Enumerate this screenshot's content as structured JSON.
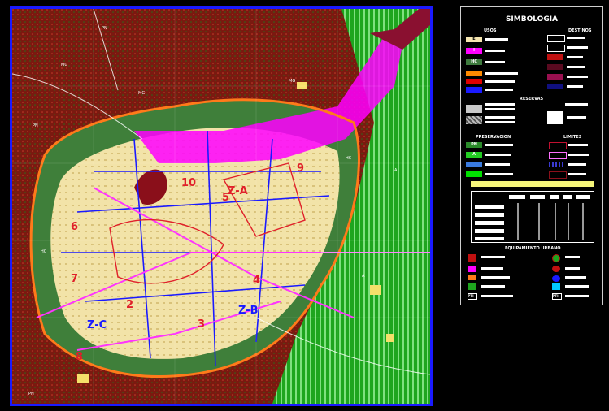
{
  "legend": {
    "title": "SIMBOLOGIA",
    "sections": {
      "usos": "USOS",
      "destinos": "DESTINOS",
      "reservas": "RESERVAS",
      "preservacion": "PRESERVACION",
      "limites": "LIMITES",
      "equipamiento": "EQUIPAMIENTO URBANO"
    },
    "usos_items": [
      {
        "code": "E",
        "color": "#f5e6b0"
      },
      {
        "code": "I",
        "color": "#ff00ff"
      },
      {
        "code": "HC",
        "color": "#3d7a3d"
      },
      {
        "code": "",
        "color": "#ff8a00"
      },
      {
        "code": "",
        "color": "#e00000"
      },
      {
        "code": "",
        "color": "#1a1aff"
      }
    ],
    "preservacion_items": [
      {
        "code": "PN",
        "color": "#2a8a2a"
      },
      {
        "code": "A",
        "color": "#22cc22"
      },
      {
        "code": "",
        "color": "#3a7adf"
      },
      {
        "code": "",
        "color": "#00e000"
      }
    ],
    "equip_codes": [
      "PTI",
      "PTI"
    ]
  },
  "map": {
    "zone_labels": [
      "Z-A",
      "Z-B",
      "Z-C",
      "9",
      "10",
      "5",
      "7",
      "2",
      "3",
      "4",
      "6",
      "8"
    ],
    "area_labels": {
      "forest": "PN",
      "mountain": "MG",
      "agri": "A",
      "habit": "HC"
    },
    "colors": {
      "forest": "#7a1a10",
      "agri_green": "#1ea51e",
      "agri_stripe": "#5dd95d",
      "urban_cream": "#f2e3a8",
      "industrial": "#ff00ff",
      "boundary_blue": "#1a1aff",
      "roads_orange": "#ff7a1a",
      "hc_green": "#3f7f3a",
      "zone_red": "#e0202a"
    }
  }
}
